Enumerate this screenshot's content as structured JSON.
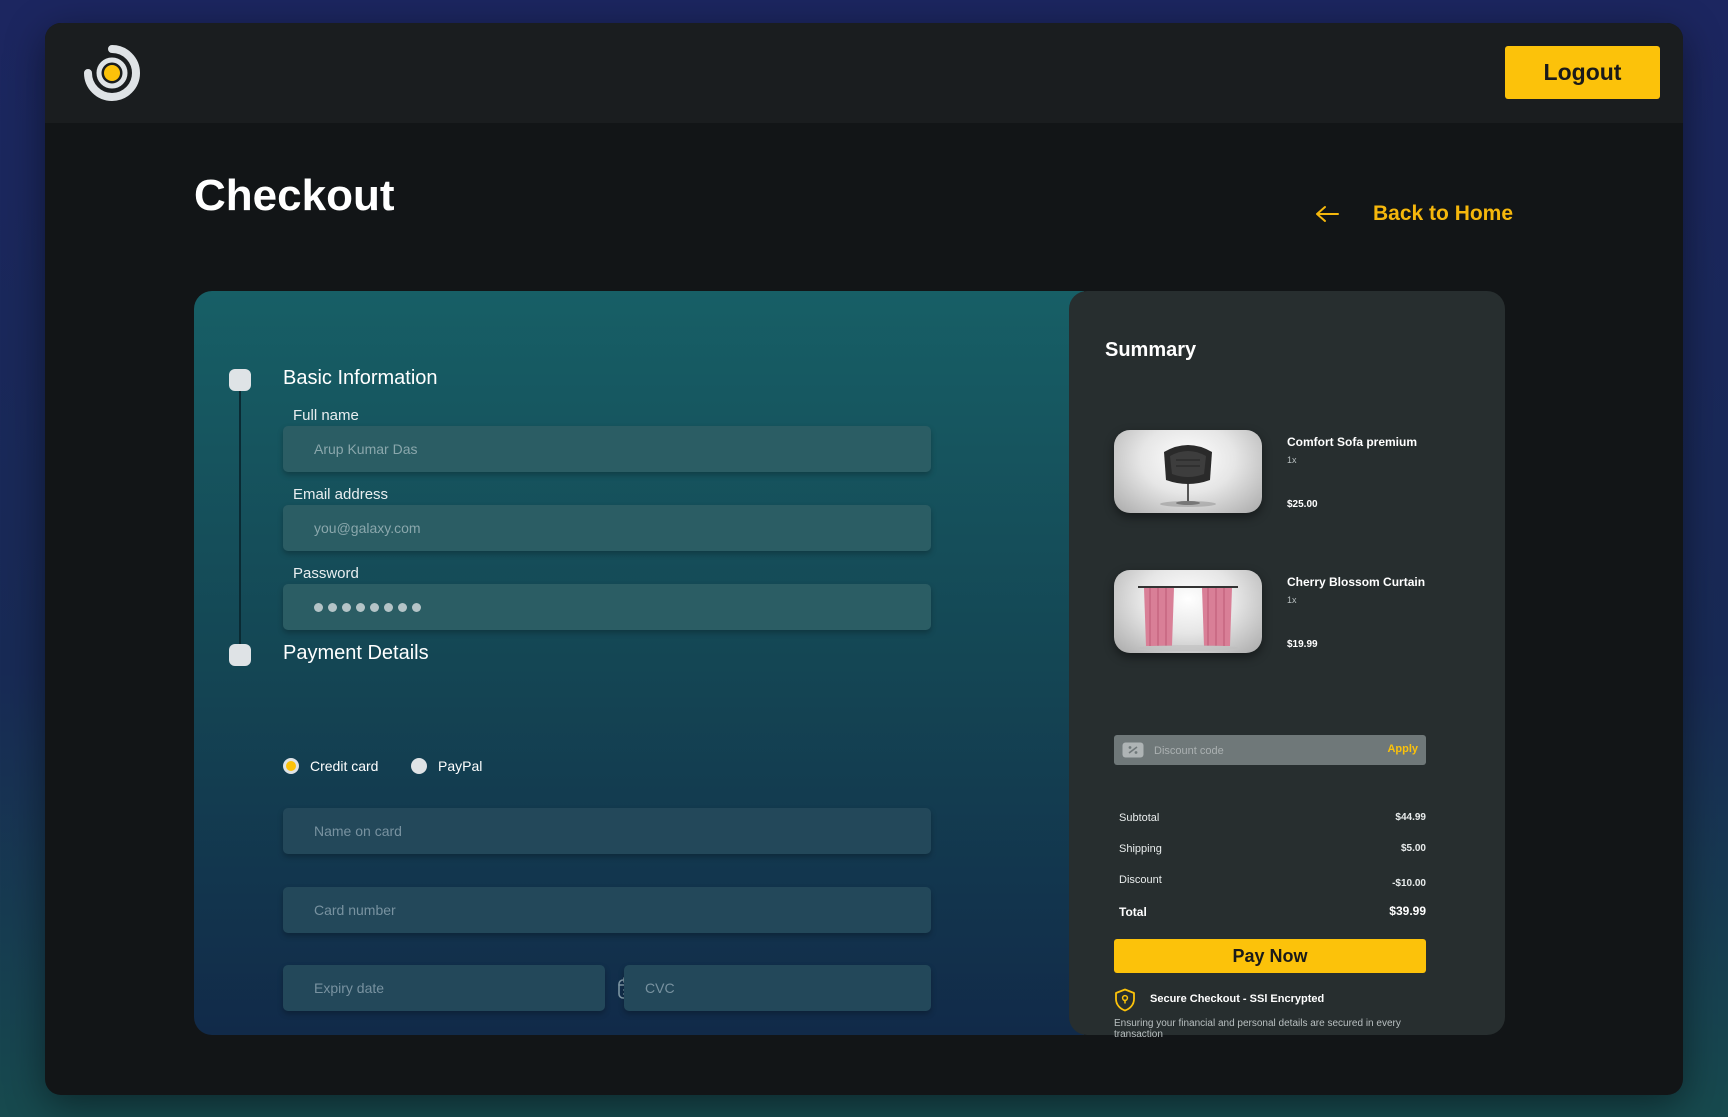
{
  "header": {
    "logo_icon": "ring-logo-icon",
    "logout_label": "Logout"
  },
  "page": {
    "title": "Checkout",
    "back_label": "Back to Home",
    "back_icon": "arrow-left-icon"
  },
  "basic_info": {
    "title": "Basic Information",
    "full_name_label": "Full name",
    "full_name_placeholder": "Arup Kumar Das",
    "email_label": "Email address",
    "email_placeholder": "you@galaxy.com",
    "password_label": "Password",
    "password_dots": 8
  },
  "payment": {
    "title": "Payment Details",
    "methods": [
      {
        "label": "Credit card",
        "selected": true
      },
      {
        "label": "PayPal",
        "selected": false
      }
    ],
    "name_on_card_placeholder": "Name on card",
    "card_number_placeholder": "Card number",
    "expiry_placeholder": "Expiry date",
    "cvc_placeholder": "CVC",
    "calendar_icon": "calendar-icon"
  },
  "summary": {
    "title": "Summary",
    "items": [
      {
        "name": "Comfort Sofa premium",
        "qty": "1x",
        "price": "$25.00",
        "image": "armchair-image"
      },
      {
        "name": "Cherry Blossom Curtain",
        "qty": "1x",
        "price": "$19.99",
        "image": "curtain-image"
      }
    ],
    "discount_placeholder": "Discount code",
    "discount_icon": "discount-tag-icon",
    "apply_label": "Apply",
    "rows": [
      {
        "label": "Subtotal",
        "value": "$44.99"
      },
      {
        "label": "Shipping",
        "value": "$5.00"
      },
      {
        "label": "Discount",
        "value": "-$10.00"
      }
    ],
    "total_label": "Total",
    "total_value": "$39.99",
    "pay_label": "Pay Now",
    "secure_icon": "shield-icon",
    "secure_title": "Secure Checkout - SSl Encrypted",
    "secure_text": "Ensuring your financial and personal details are secured in every transaction"
  },
  "colors": {
    "accent": "#fcc20a",
    "panel_teal": "#175f66",
    "summary_bg": "#272e2f"
  }
}
